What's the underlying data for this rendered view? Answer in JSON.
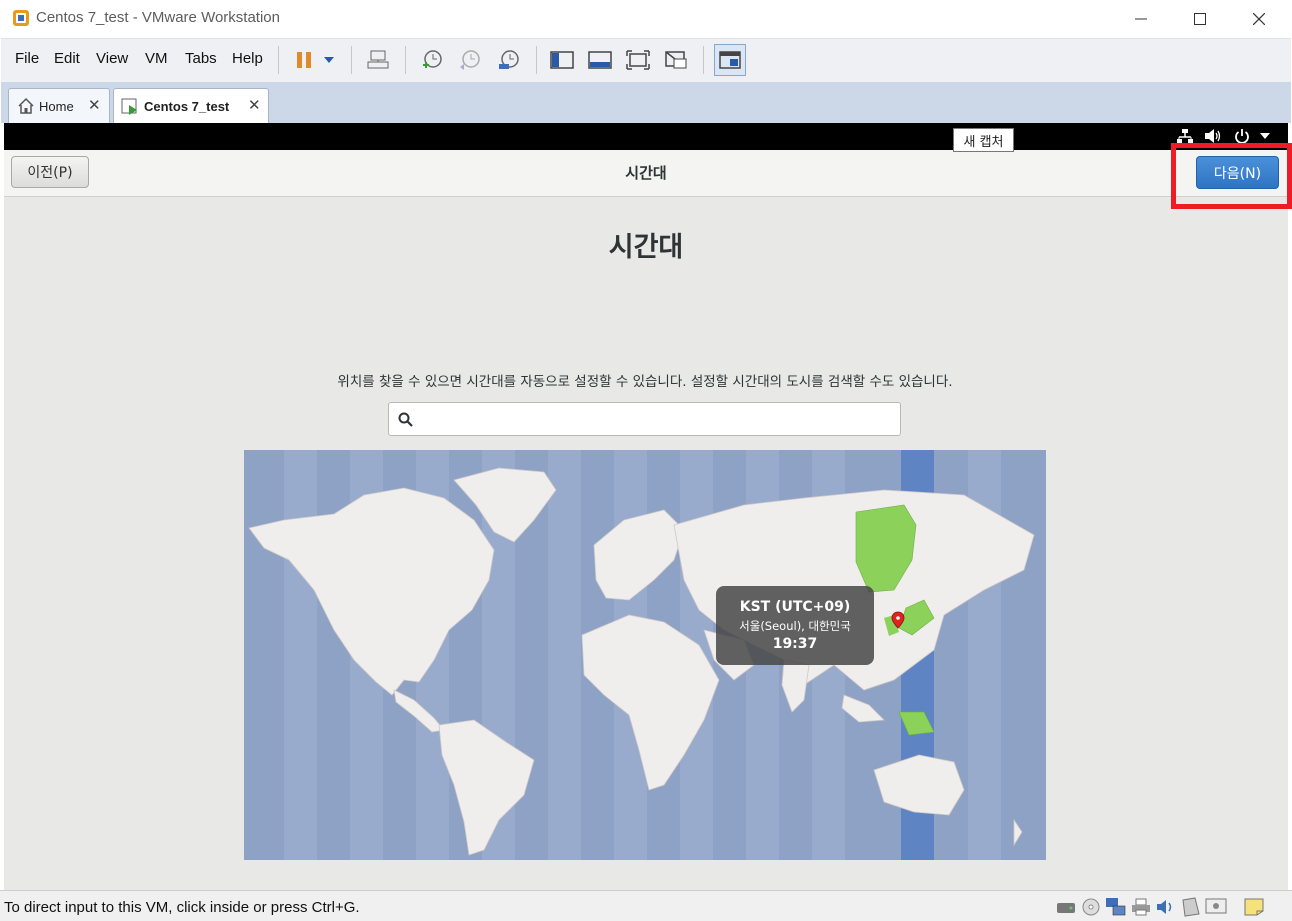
{
  "window": {
    "title": "Centos 7_test - VMware Workstation",
    "icon": "vmware-icon",
    "controls": [
      "minimize-icon",
      "maximize-icon",
      "close-icon"
    ]
  },
  "menu": {
    "items": [
      "File",
      "Edit",
      "View",
      "VM",
      "Tabs",
      "Help"
    ]
  },
  "toolbar": {
    "icons": [
      "pause-icon",
      "dropdown-icon",
      "send-ctrl-alt-del-icon",
      "snapshot-take-icon",
      "snapshot-revert-icon",
      "snapshot-manager-icon",
      "show-library-icon",
      "quick-switch-icon",
      "full-screen-icon",
      "unity-icon",
      "console-view-icon"
    ]
  },
  "tabs": [
    {
      "label": "Home",
      "icon": "home-icon",
      "active": false
    },
    {
      "label": "Centos 7_test",
      "icon": "vm-running-icon",
      "active": true
    }
  ],
  "vm": {
    "topbar_icons": [
      "network-icon",
      "volume-icon",
      "power-icon",
      "chevron-down-icon"
    ],
    "tooltip": "새 캡처",
    "header": {
      "back_label": "이전(P)",
      "title": "시간대",
      "next_label": "다음(N)"
    },
    "heading": "시간대",
    "description": "위치를 찾을 수 있으면 시간대를 자동으로 설정할 수 있습니다. 설정할 시간대의 도시를 검색할 수도 있습니다.",
    "search": {
      "value": "",
      "icon": "search-icon"
    },
    "map": {
      "timezone": "KST (UTC+09)",
      "city": "서울(Seoul), 대한민국",
      "time": "19:37",
      "highlight_color": "#8cd15a",
      "ocean_color": "#8ea2c5"
    }
  },
  "statusbar": {
    "text": "To direct input to this VM, click inside or press Ctrl+G.",
    "icons": [
      "hdd-icon",
      "cdrom-icon",
      "network-adapter-icon",
      "printer-icon",
      "sound-icon",
      "usb-icon",
      "display-icon",
      "message-icon"
    ]
  },
  "colors": {
    "accent": "#2f74c3",
    "highlight_box": "#ee1c25"
  }
}
